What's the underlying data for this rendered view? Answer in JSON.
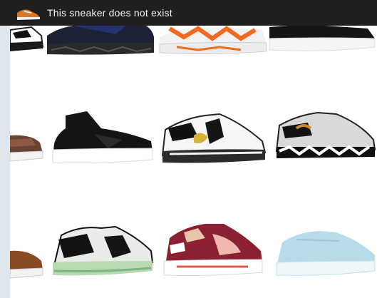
{
  "app": {
    "title": "This sneaker does not exist",
    "logo_icon": "sneaker-logo-icon",
    "bar_color": "#1f1f1f"
  },
  "grid": {
    "rows": 3,
    "columns": 4,
    "cells": [
      {
        "icon": "sneaker-white-black-icon"
      },
      {
        "icon": "sneaker-black-navy-icon"
      },
      {
        "icon": "sneaker-white-orange-icon"
      },
      {
        "icon": "sneaker-black-white-icon"
      },
      {
        "icon": "sneaker-brown-icon"
      },
      {
        "icon": "sneaker-black-icon"
      },
      {
        "icon": "sneaker-white-black-yellow-icon"
      },
      {
        "icon": "sneaker-grey-black-icon"
      },
      {
        "icon": "sneaker-brown-leather-icon"
      },
      {
        "icon": "sneaker-black-green-icon"
      },
      {
        "icon": "sneaker-maroon-pink-icon"
      },
      {
        "icon": "sneaker-light-blue-icon"
      }
    ]
  }
}
